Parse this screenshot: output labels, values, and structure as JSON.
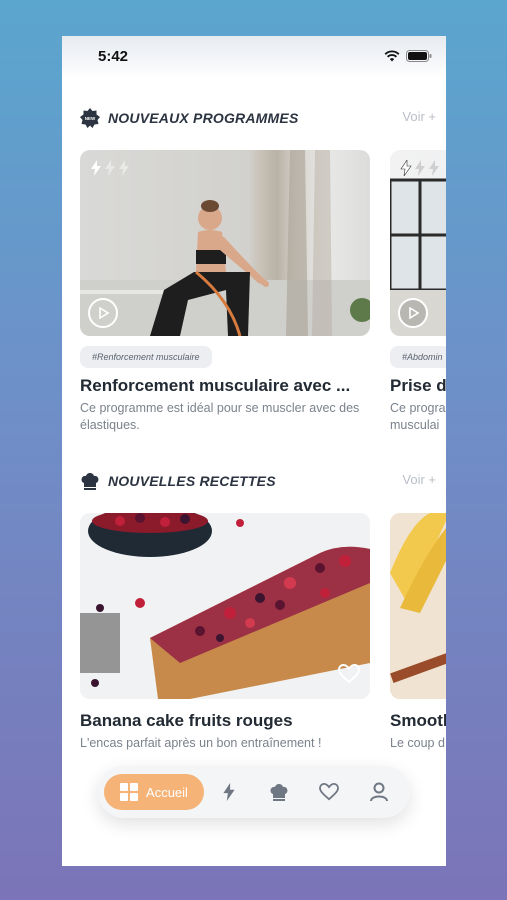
{
  "status": {
    "time": "5:42"
  },
  "sections": [
    {
      "title": "NOUVEAUX PROGRAMMES",
      "more": "Voir +"
    },
    {
      "title": "NOUVELLES RECETTES",
      "more": "Voir +"
    }
  ],
  "programs": [
    {
      "tag": "#Renforcement musculaire",
      "title": "Renforcement musculaire avec ...",
      "description": "Ce programme est idéal pour se muscler avec des élastiques.",
      "intensity_level": 1,
      "intensity_max": 3
    },
    {
      "tag": "#Abdomin",
      "title": "Prise d",
      "description": "Ce progra musculai",
      "intensity_level": 1,
      "intensity_max": 3
    }
  ],
  "recipes": [
    {
      "title": "Banana cake fruits rouges",
      "description": "L'encas parfait après un bon entraînement !"
    },
    {
      "title": "Smooth",
      "description": "Le coup d"
    }
  ],
  "nav": {
    "active_label": "Accueil",
    "items": [
      "home-icon",
      "bolt-icon",
      "chef-hat-icon",
      "heart-icon",
      "user-icon"
    ]
  },
  "colors": {
    "accent": "#f6b377",
    "title": "#2b3440",
    "muted": "#7b828c",
    "voir": "#b9bec6"
  }
}
